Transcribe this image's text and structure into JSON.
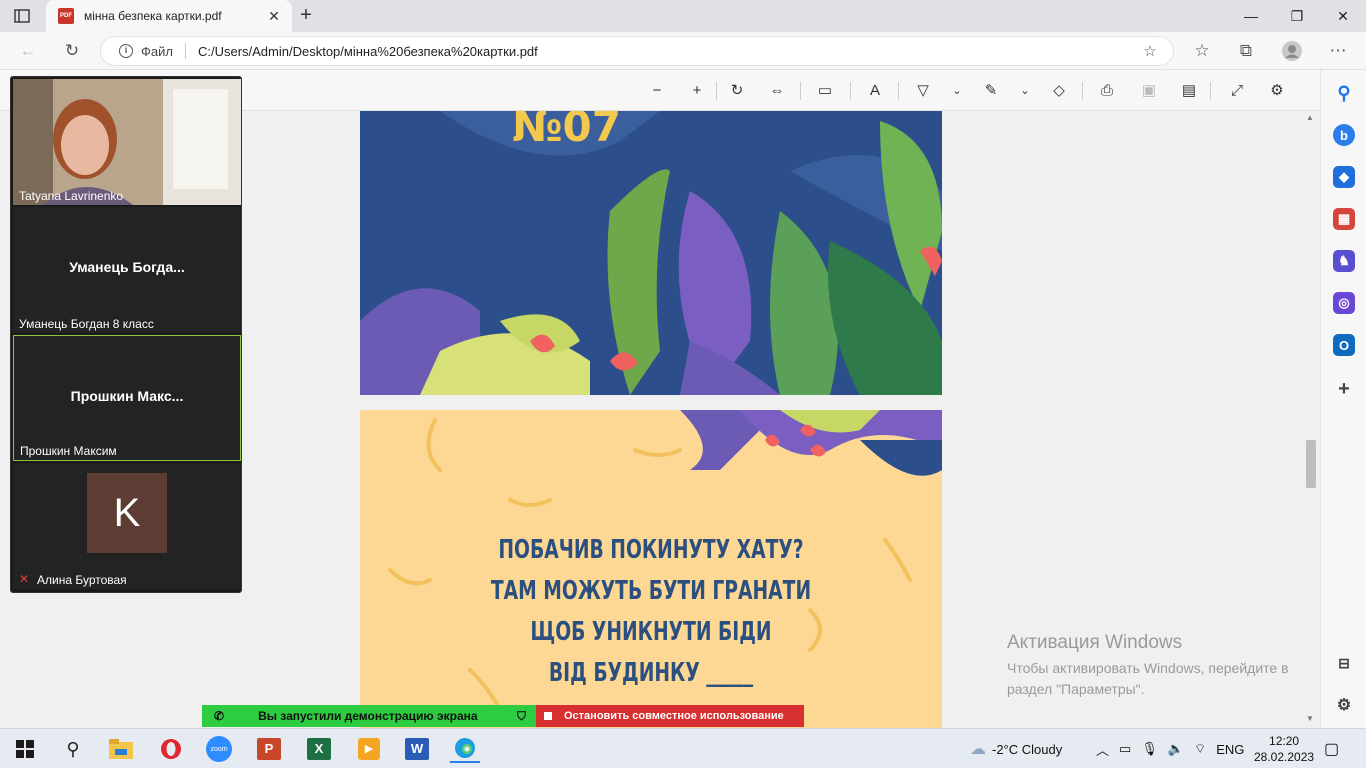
{
  "browser": {
    "tab_title": "мінна безпека картки.pdf",
    "pdf_badge": "PDF",
    "address_scheme": "Файл",
    "address_url": "C:/Users/Admin/Desktop/мінна%20безпека%20картки.pdf"
  },
  "pdf": {
    "page1_heading": "№07",
    "card_lines": [
      "ПОБАЧИВ ПОКИНУТУ ХАТУ?",
      "ТАМ МОЖУТЬ БУТИ ГРАНАТИ",
      "ЩОБ УНИКНУТИ БІДИ",
      "ВІД БУДИНКУ _____"
    ],
    "scroll_position": 0.58
  },
  "zoom": {
    "participants": [
      {
        "display": "",
        "label": "Tatyana Lavrinenko",
        "video": true
      },
      {
        "display": "Уманець  Богда...",
        "label": "Уманець Богдан 8 класс",
        "video": false
      },
      {
        "display": "Прошкин  Макс...",
        "label": "Прошкин Максим",
        "video": false,
        "active": true
      },
      {
        "display": "K",
        "label": "Алина Буртовая",
        "video": false,
        "muted": true
      }
    ],
    "share_status": "Вы запустили демонстрацию экрана",
    "stop_share": "Остановить совместное использование"
  },
  "activation": {
    "title": "Активация Windows",
    "line1": "Чтобы активировать Windows, перейдите в",
    "line2": "раздел \"Параметры\"."
  },
  "taskbar": {
    "weather": "-2°C  Cloudy",
    "lang": "ENG",
    "time": "12:20",
    "date": "28.02.2023",
    "zoom_label": "zoom"
  },
  "colors": {
    "share_green": "#2ecc40",
    "share_red": "#d83030",
    "active_tile_border": "#8fc63d",
    "card_bg": "#fdd894",
    "page1_bg": "#2c4f8c"
  }
}
